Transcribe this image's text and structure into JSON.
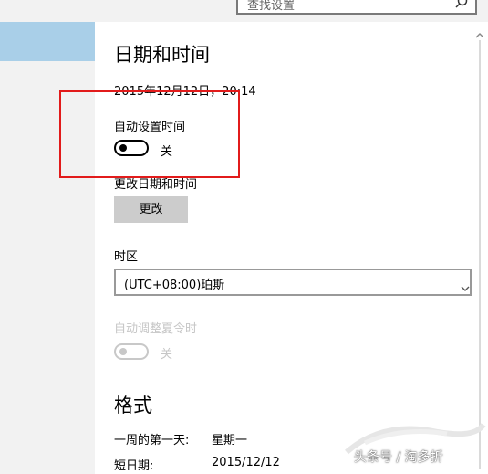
{
  "search": {
    "placeholder": "查找设置"
  },
  "page": {
    "title": "日期和时间",
    "current_datetime": "2015年12月12日，20:14"
  },
  "auto_time": {
    "label": "自动设置时间",
    "state": "关"
  },
  "change_datetime": {
    "label": "更改日期和时间",
    "button": "更改"
  },
  "timezone": {
    "label": "时区",
    "value": "(UTC+08:00)珀斯"
  },
  "dst": {
    "label": "自动调整夏令时",
    "state": "关"
  },
  "format": {
    "title": "格式",
    "rows": [
      {
        "label": "一周的第一天:",
        "value": "星期一"
      },
      {
        "label": "短日期:",
        "value": "2015/12/12"
      }
    ]
  },
  "watermark": {
    "text": "头条号 / 淘多折"
  },
  "colors": {
    "highlight_box": "#e21b1b",
    "sidebar_selected": "#a9cfe8",
    "button": "#cccccc"
  },
  "icons": {
    "search": "search-icon",
    "dropdown": "chevron-down-icon",
    "scroll_up": "chevron-up-icon"
  }
}
